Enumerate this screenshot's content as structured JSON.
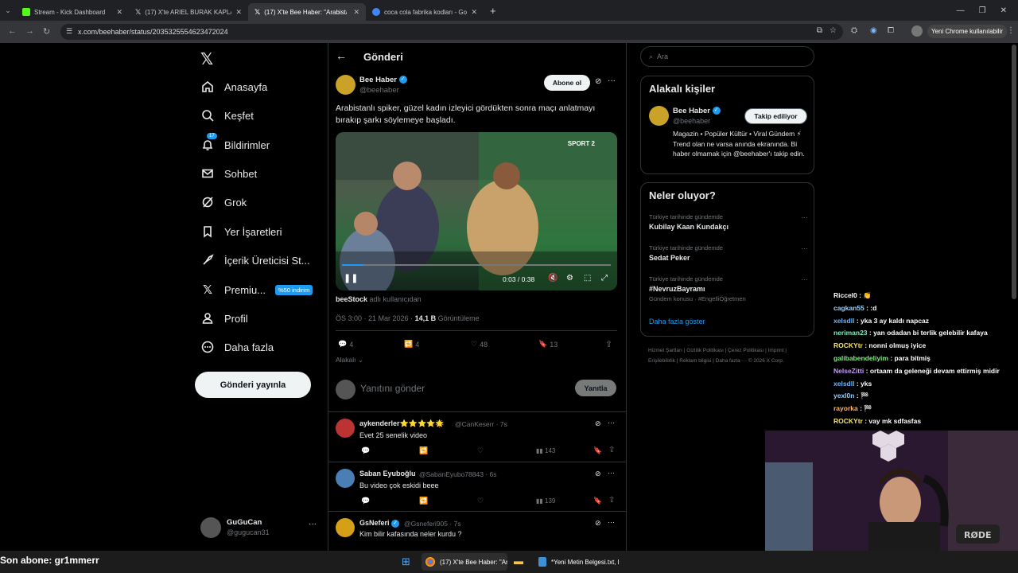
{
  "browser": {
    "tabs": [
      {
        "label": "Stream - Kick Dashboard",
        "color": "#53fc18"
      },
      {
        "label": "(17) X'te ARIEL BURAK KAPLAN",
        "color": "#ffffff"
      },
      {
        "label": "(17) X'te Bee Haber: \"Arabistan",
        "color": "#ffffff"
      },
      {
        "label": "coca cola fabrika kodları - Goo",
        "color": "#4285f4"
      }
    ],
    "url": "x.com/beehaber/status/2035325554623472024",
    "profile_label": "Yeni Chrome kullanılabilir"
  },
  "nav": {
    "items": [
      {
        "label": "Anasayfa",
        "icon": "home-icon"
      },
      {
        "label": "Keşfet",
        "icon": "search-icon"
      },
      {
        "label": "Bildirimler",
        "icon": "bell-icon",
        "badge": "17"
      },
      {
        "label": "Sohbet",
        "icon": "mail-icon"
      },
      {
        "label": "Grok",
        "icon": "grok-icon"
      },
      {
        "label": "Yer İşaretleri",
        "icon": "bookmark-icon"
      },
      {
        "label": "İçerik Üreticisi St...",
        "icon": "rocket-icon"
      },
      {
        "label": "Premiu...",
        "icon": "x-logo-icon",
        "badge": "%50 indirim"
      },
      {
        "label": "Profil",
        "icon": "person-icon"
      },
      {
        "label": "Daha fazla",
        "icon": "more-circle-icon"
      }
    ],
    "post_button": "Gönderi yayınla",
    "user": {
      "name": "GuGuCan",
      "handle": "@gugucan31"
    }
  },
  "post": {
    "header_title": "Gönderi",
    "author": {
      "name": "Bee Haber",
      "handle": "@beehaber"
    },
    "subscribe_label": "Abone ol",
    "text": "Arabistanlı spiker, güzel kadın izleyici gördükten sonra maçı anlatmayı bırakıp şarkı söylemeye başladı.",
    "video": {
      "time": "0:03 / 0:38",
      "watermark": "SPORT 2",
      "progress": 0.08
    },
    "source_user": "beeStock",
    "source_suffix": "adlı kullanıcıdan",
    "meta": "ÖS 3:00 · 21 Mar 2026 · ",
    "views": "14,1 B",
    "views_label": "Görüntüleme",
    "stats": {
      "replies": "4",
      "retweets": "4",
      "likes": "48",
      "bookmarks": "13"
    },
    "related_label": "Alakalı",
    "reply_placeholder": "Yanıtını gönder",
    "reply_button": "Yanıtla"
  },
  "replies": [
    {
      "name": "aykenderler⭐⭐⭐⭐🌟",
      "handle": "@CanKeserr · 7s",
      "text": "Evet 25 senelik video",
      "views": "143"
    },
    {
      "name": "Saban Eyuboğlu",
      "handle": "@SabanEyubo78843 · 6s",
      "text": "Bu video çok eskidi beee",
      "views": "139"
    },
    {
      "name": "GsNeferi",
      "handle": "@Gsneferi905 · 7s",
      "text": "Kim bilir kafasında neler kurdu ?",
      "views": "…"
    }
  ],
  "sidebar": {
    "search_placeholder": "Ara",
    "related_title": "Alakalı kişiler",
    "person": {
      "name": "Bee Haber",
      "handle": "@beehaber",
      "follow_label": "Takip ediliyor",
      "bio": "Magazin • Popüler Kültür • Viral Gündem ⚡ Trend olan ne varsa anında ekranında. Bi haber olmamak için @beehaber'ı takip edin."
    },
    "trends_title": "Neler oluyor?",
    "trends": [
      {
        "context": "Türkiye tarihinde gündemde",
        "title": "Kubilay Kaan Kundakçı"
      },
      {
        "context": "Türkiye tarihinde gündemde",
        "title": "Sedat Peker"
      },
      {
        "context": "Türkiye tarihinde gündemde",
        "title": "#NevruzBayramı",
        "extra": "Gündem konusu · #EngelliÖğretmen"
      }
    ],
    "show_more": "Daha fazla göster",
    "footer": "Hizmet Şartları | Gizlilik Politikası | Çerez Politikası | Imprint | Erişilebilirlik | Reklam bilgisi | Daha fazla ··· © 2026 X Corp."
  },
  "chat": [
    {
      "user": "Riccel0",
      "msg": ": 👏",
      "color": "#ffffff"
    },
    {
      "user": "cagkan55",
      "msg": ": :d",
      "color": "#9ad0ff"
    },
    {
      "user": "xelsdll",
      "msg": ": yka 3 ay kaldı napcaz",
      "color": "#6fb5ff"
    },
    {
      "user": "neriman23",
      "msg": ": yan odadan bi terlik gelebilir kafaya",
      "color": "#7cf2c0"
    },
    {
      "user": "ROCKYtr",
      "msg": ": nonni olmuş iyice",
      "color": "#f5e663"
    },
    {
      "user": "galibabendeliyim",
      "msg": ": para bitmiş",
      "color": "#7cf27c"
    },
    {
      "user": "NelseZitti",
      "msg": ": ortaam da geleneği devam ettirmiş midir",
      "color": "#c89bff"
    },
    {
      "user": "xelsdll",
      "msg": ": yks",
      "color": "#6fb5ff"
    },
    {
      "user": "yexl0n",
      "msg": ": 🏁",
      "color": "#8fd0ff"
    },
    {
      "user": "rayorka",
      "msg": ": 🏁",
      "color": "#ffb36b"
    },
    {
      "user": "ROCKYtr",
      "msg": ": vay mk sdfasfas",
      "color": "#f5e663"
    }
  ],
  "overlay": {
    "subscriber": "Son abone: gr1mmerr"
  },
  "taskbar": {
    "chrome_label": "(17) X'te Bee Haber: \"Ar",
    "notepad_label": "*Yeni Metin Belgesi.txt, l"
  },
  "colors": {
    "accent": "#1d9bf0",
    "premium_badge": "#1d9bf0",
    "background": "#000000"
  }
}
